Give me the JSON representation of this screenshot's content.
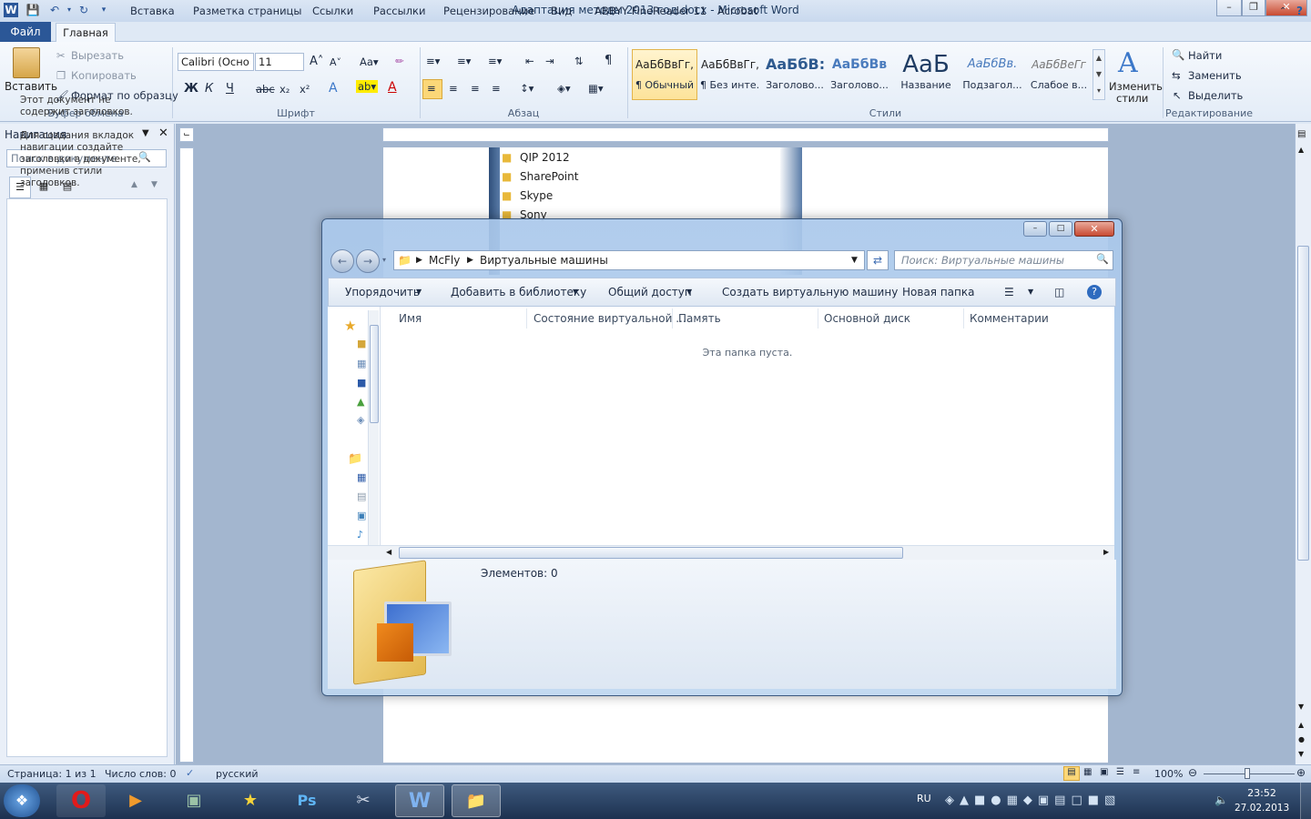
{
  "window": {
    "title": "Адаптация методы 2013 год.docx - Microsoft Word"
  },
  "tabs": {
    "file": "Файл",
    "items": [
      "Главная",
      "Вставка",
      "Разметка страницы",
      "Ссылки",
      "Рассылки",
      "Рецензирование",
      "Вид",
      "ABBYY FineReader 11",
      "Acrobat"
    ]
  },
  "clipboard": {
    "paste": "Вставить",
    "cut": "Вырезать",
    "copy": "Копировать",
    "format_painter": "Формат по образцу",
    "label": "Буфер обмена"
  },
  "font": {
    "name": "Calibri (Осно",
    "size": "11",
    "label": "Шрифт"
  },
  "paragraph": {
    "label": "Абзац"
  },
  "styles": {
    "label": "Стили",
    "items": [
      {
        "preview": "АаБбВвГг,",
        "name": "¶ Обычный"
      },
      {
        "preview": "АаБбВвГг,",
        "name": "¶ Без инте..."
      },
      {
        "preview": "АаБбВ:",
        "name": "Заголово..."
      },
      {
        "preview": "АаБбВв",
        "name": "Заголово..."
      },
      {
        "preview": "АаБ",
        "name": "Название"
      },
      {
        "preview": "АаБбВв.",
        "name": "Подзагол..."
      },
      {
        "preview": "АаБбВеГг",
        "name": "Слабое в..."
      }
    ],
    "change_line1": "Изменить",
    "change_line2": "стили"
  },
  "editing": {
    "label": "Редактирование",
    "find": "Найти",
    "replace": "Заменить",
    "select": "Выделить"
  },
  "nav": {
    "title": "Навигация",
    "search_placeholder": "Поиск в документе",
    "msg1": "Этот документ не содержит заголовков.",
    "msg2": "Для создания вкладок навигации создайте заголовки в документе, применив стили заголовков."
  },
  "doc_folders": [
    "QIP 2012",
    "SharePoint",
    "Skype",
    "Sony"
  ],
  "explorer": {
    "breadcrumb": [
      "McFly",
      "Виртуальные машины"
    ],
    "search_placeholder": "Поиск: Виртуальные машины",
    "commands": {
      "organize": "Упорядочить",
      "add_library": "Добавить в библиотеку",
      "share": "Общий доступ",
      "create_vm": "Создать виртуальную машину",
      "new_folder": "Новая папка"
    },
    "columns": [
      "Имя",
      "Состояние виртуальной ...",
      "Память",
      "Основной диск",
      "Комментарии"
    ],
    "empty_text": "Эта папка пуста.",
    "items_count": "Элементов: 0"
  },
  "status": {
    "page": "Страница: 1 из 1",
    "words": "Число слов: 0",
    "language": "русский",
    "zoom": "100%"
  },
  "taskbar": {
    "lang": "RU",
    "time": "23:52",
    "date": "27.02.2013"
  },
  "colors": {
    "file_tab": "#2b5797",
    "accent": "#1e5fa8"
  }
}
